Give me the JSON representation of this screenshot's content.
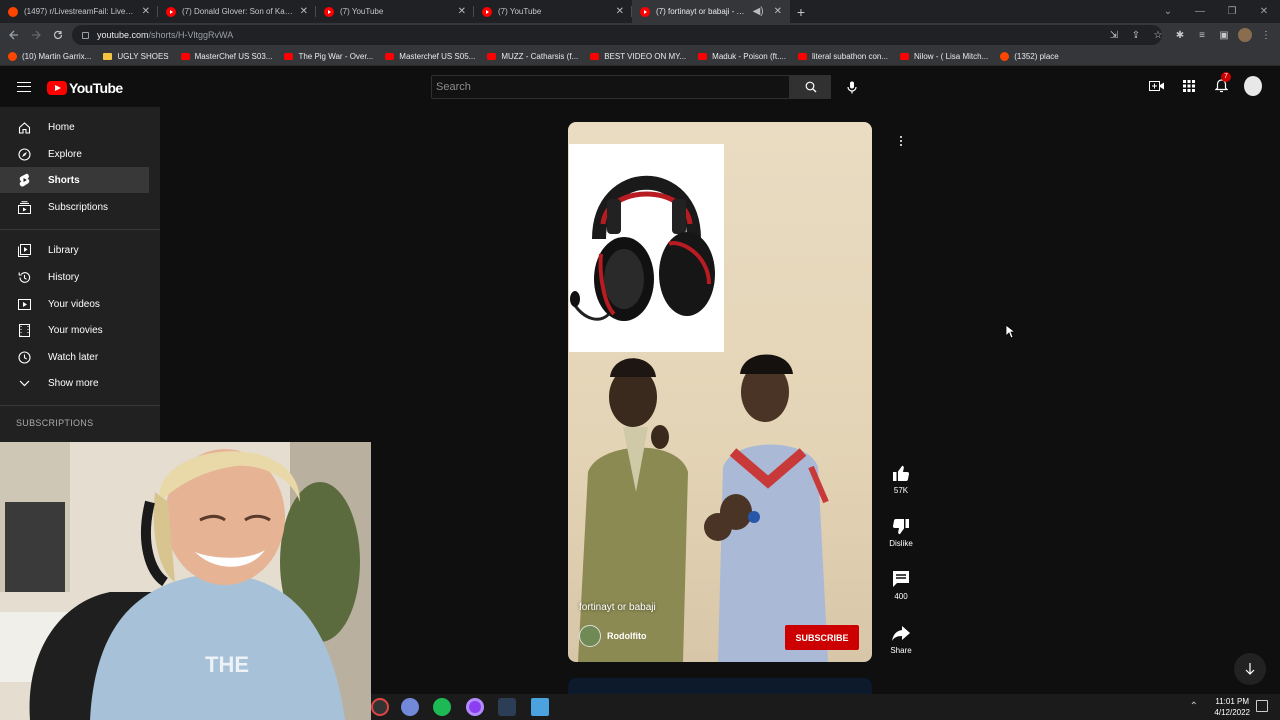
{
  "browser": {
    "tabs": [
      {
        "title": "(1497) r/LivestreamFail: Livestrea",
        "favicon": "reddit-icon",
        "active": false
      },
      {
        "title": "(7) Donald Glover: Son of Kanye",
        "favicon": "youtube-icon",
        "active": false
      },
      {
        "title": "(7) YouTube",
        "favicon": "youtube-icon",
        "active": false
      },
      {
        "title": "(7) YouTube",
        "favicon": "youtube-icon",
        "active": false
      },
      {
        "title": "(7) fortinayt or babaji - YouTu",
        "favicon": "youtube-icon",
        "active": true
      }
    ],
    "url_host": "youtube.com",
    "url_path": "/shorts/H-VltggRvWA",
    "bookmarks": [
      {
        "label": "(10) Martin Garrix...",
        "icon": "reddit-icon"
      },
      {
        "label": "UGLY SHOES",
        "icon": "folder-icon"
      },
      {
        "label": "MasterChef US S03...",
        "icon": "youtube-icon"
      },
      {
        "label": "The Pig War - Over...",
        "icon": "youtube-icon"
      },
      {
        "label": "Masterchef US S05...",
        "icon": "youtube-icon"
      },
      {
        "label": "MUZZ - Catharsis (f...",
        "icon": "youtube-icon"
      },
      {
        "label": "BEST VIDEO ON MY...",
        "icon": "youtube-icon"
      },
      {
        "label": "Maduk - Poison (ft....",
        "icon": "youtube-icon"
      },
      {
        "label": "literal subathon con...",
        "icon": "youtube-icon"
      },
      {
        "label": "Nilow - ( Lisa Mitch...",
        "icon": "youtube-icon"
      },
      {
        "label": "(1352) place",
        "icon": "reddit-icon"
      }
    ]
  },
  "youtube": {
    "logo_text": "YouTube",
    "search_placeholder": "Search",
    "notification_count": "7",
    "sidebar": {
      "items": [
        {
          "label": "Home",
          "icon": "home-icon",
          "active": false
        },
        {
          "label": "Explore",
          "icon": "compass-icon",
          "active": false
        },
        {
          "label": "Shorts",
          "icon": "shorts-icon",
          "active": true
        },
        {
          "label": "Subscriptions",
          "icon": "subscriptions-icon",
          "active": false
        }
      ],
      "library_items": [
        {
          "label": "Library",
          "icon": "library-icon"
        },
        {
          "label": "History",
          "icon": "history-icon"
        },
        {
          "label": "Your videos",
          "icon": "your-videos-icon"
        },
        {
          "label": "Your movies",
          "icon": "movies-icon"
        },
        {
          "label": "Watch later",
          "icon": "clock-icon"
        },
        {
          "label": "Show more",
          "icon": "chevron-down-icon"
        }
      ],
      "section_heading": "SUBSCRIPTIONS"
    },
    "short": {
      "title": "fortinayt or babaji",
      "channel": "Rodolfito",
      "subscribe_label": "SUBSCRIBE",
      "likes": "57K",
      "dislike_label": "Dislike",
      "comments": "400",
      "share_label": "Share"
    }
  },
  "taskbar": {
    "time": "11:01 PM",
    "date": "4/12/2022"
  },
  "colors": {
    "yt_red": "#ff0000",
    "subscribe_red": "#cc0000",
    "background": "#0f0f0f",
    "sidebar": "#212121"
  }
}
